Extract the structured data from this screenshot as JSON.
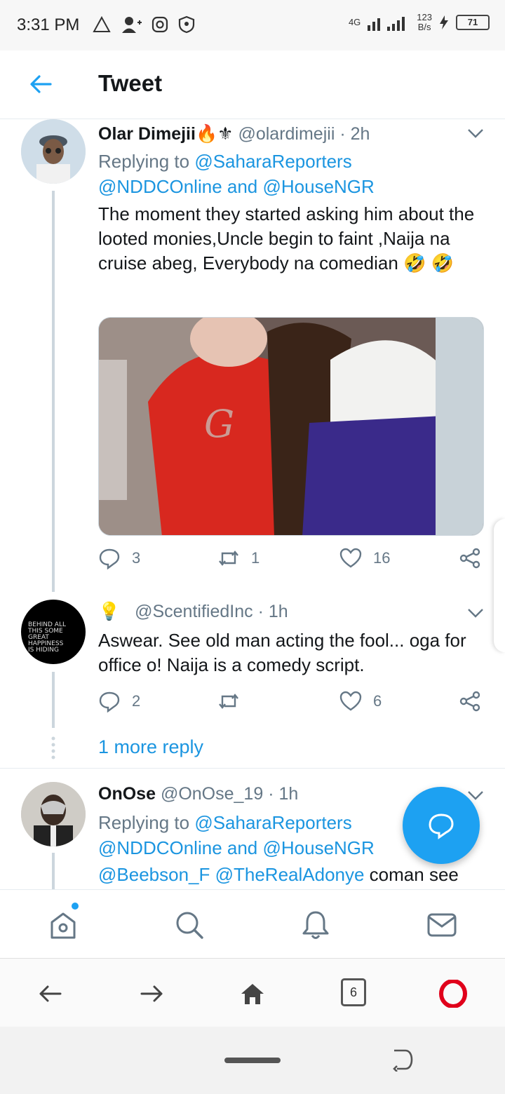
{
  "status_bar": {
    "time": "3:31 PM",
    "network_type": "4G",
    "speed_value": "123",
    "speed_unit": "B/s",
    "battery": "71",
    "icons": [
      "alert-icon",
      "add-user-icon",
      "instagram-icon",
      "shield-icon",
      "signal-icon",
      "charging-icon"
    ]
  },
  "header": {
    "title": "Tweet"
  },
  "tweets": [
    {
      "name": "Olar Dimejii",
      "name_emojis": "🔥⚜",
      "handle": "@olardimejii",
      "time": "· 2h",
      "replying_prefix": "Replying to ",
      "replying_line1": "@SaharaReporters",
      "replying_line2": "@NDDCOnline and @HouseNGR",
      "text": "The moment they started asking him about the looted monies,Uncle begin to faint ,Naija na cruise abeg, Everybody na comedian 🤣 🤣",
      "replies": "3",
      "retweets": "1",
      "likes": "16"
    },
    {
      "name_emoji": "💡",
      "handle": "@ScentifiedInc",
      "time": "· 1h",
      "avatar_text": "BEHIND ALL THIS SOME GREAT HAPPINESS IS HIDING",
      "text": "Aswear. See old man acting the fool... oga for office o! Naija is a comedy script.",
      "replies": "2",
      "retweets": "",
      "likes": "6",
      "more_replies": "1 more reply"
    },
    {
      "name": "OnOse",
      "handle": "@OnOse_19",
      "time": "· 1h",
      "replying_prefix": "Replying to ",
      "replying_line1": "@SaharaReporters",
      "replying_line2": "@NDDCOnline and @HouseNGR",
      "text_mentions": "@Beebson_F @TheRealAdonye",
      "text_rest": " coman see"
    }
  ],
  "browser": {
    "tab_count": "6"
  },
  "colors": {
    "accent": "#1da1f2",
    "link": "#1b95e0",
    "muted": "#657786",
    "opera_red": "#e0001b"
  }
}
